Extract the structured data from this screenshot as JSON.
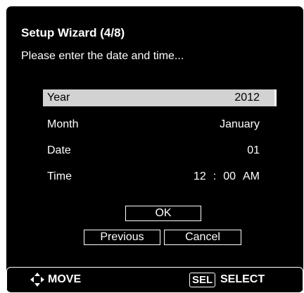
{
  "wizard": {
    "title": "Setup Wizard (4/8)",
    "prompt": "Please enter the date and time..."
  },
  "fields": [
    {
      "label": "Year",
      "value": "2012",
      "selected": true
    },
    {
      "label": "Month",
      "value": "January",
      "selected": false
    },
    {
      "label": "Date",
      "value": "01",
      "selected": false
    },
    {
      "label": "Time",
      "hour": "12",
      "separator": ":",
      "minute": "00",
      "meridiem": "AM",
      "selected": false
    }
  ],
  "buttons": {
    "ok": "OK",
    "previous": "Previous",
    "cancel": "Cancel"
  },
  "footer": {
    "move_icon": "four-way-arrow-icon",
    "move_label": "MOVE",
    "sel_key": "SEL",
    "select_label": "SELECT"
  },
  "colors": {
    "background": "#000000",
    "text": "#ffffff",
    "selected_row": "#d2d2d2"
  }
}
